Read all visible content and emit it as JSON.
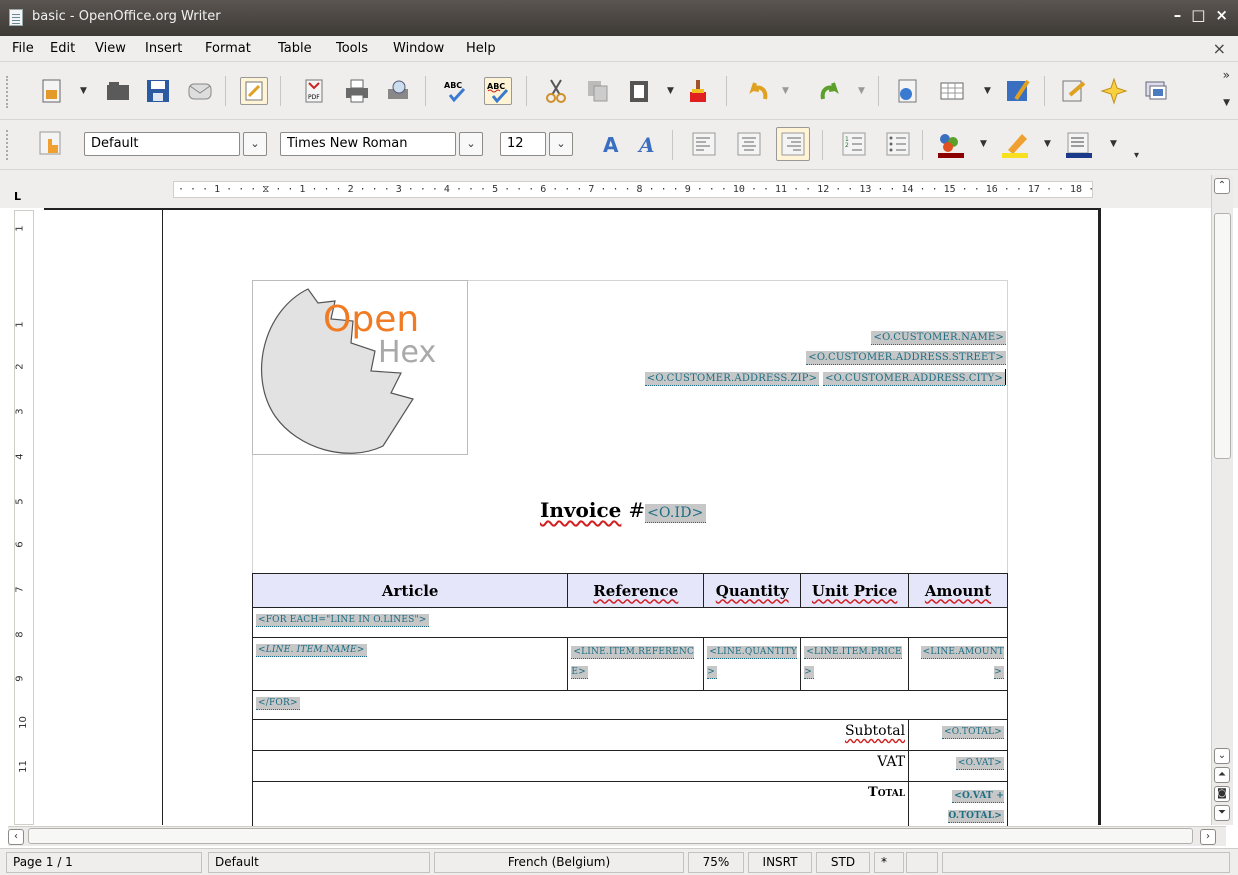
{
  "window": {
    "title": "basic - OpenOffice.org Writer",
    "controls": [
      "–",
      "□",
      "×"
    ]
  },
  "menu": {
    "items": [
      "File",
      "Edit",
      "View",
      "Insert",
      "Format",
      "Table",
      "Tools",
      "Window",
      "Help"
    ],
    "close_label": "×"
  },
  "format_toolbar": {
    "paragraph_style": "Default",
    "font_name": "Times New Roman",
    "font_size": "12"
  },
  "ruler": {
    "horizontal_text": "· · · 1 · · · ⧖ · · 1 · · · 2 · · · 3 · · · 4 · · · 5 · · · 6 · · · 7 · · · 8 · · · 9 · · · 10 · · 11 · · 12 · · 13 · · 14 · · 15 · · 16 · · 17 · · 18 · · ·",
    "vertical_numbers": [
      "1",
      "1",
      "2",
      "3",
      "4",
      "5",
      "6",
      "7",
      "8",
      "9",
      "10",
      "11"
    ],
    "corner": "L"
  },
  "document": {
    "logo": {
      "word1": "Open",
      "word2": "Hex"
    },
    "address": {
      "name": "<O.CUSTOMER.NAME>",
      "street": "<O.CUSTOMER.ADDRESS.STREET>",
      "zip": "<O.CUSTOMER.ADDRESS.ZIP>",
      "city": "<O.CUSTOMER.ADDRESS.CITY>"
    },
    "invoice_label": "Invoice",
    "invoice_hash": "#",
    "invoice_id": "<O.ID>",
    "table": {
      "headers": [
        "Article",
        "Reference",
        "Quantity",
        "Unit Price",
        "Amount"
      ],
      "for_each": "<FOR EACH=\"LINE IN O.LINES\">",
      "line": {
        "name": "<LINE. ITEM.NAME>",
        "reference": "<LINE.ITEM.REFERENCE>",
        "quantity": "<LINE.QUANTITY>",
        "price": "<LINE.ITEM.PRICE>",
        "amount": "<LINE.AMOUNT>"
      },
      "end_for": "</FOR>",
      "subtotal_label": "Subtotal",
      "subtotal_value": "<O.TOTAL>",
      "vat_label": "VAT",
      "vat_value": "<O.VAT>",
      "total_label": "Total",
      "total_value": "<O.VAT + O.TOTAL>"
    }
  },
  "statusbar": {
    "page": "Page 1 / 1",
    "style": "Default",
    "language": "French (Belgium)",
    "zoom": "75%",
    "insert_mode": "INSRT",
    "selection_mode": "STD",
    "modified": "*"
  },
  "colors": {
    "accent_orange": "#f07b22",
    "field_bg": "#c7c7c7",
    "field_text": "#1c6e84",
    "header_bg": "#e6e6fb"
  }
}
